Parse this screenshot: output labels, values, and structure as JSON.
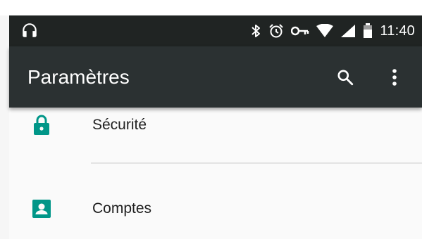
{
  "status_bar": {
    "time": "11:40",
    "left_icon": "headphones-icon",
    "right_icons": [
      "bluetooth-icon",
      "alarm-icon",
      "vpn-key-icon",
      "wifi-icon",
      "cell-signal-icon",
      "battery-icon"
    ]
  },
  "app_bar": {
    "title": "Paramètres",
    "actions": [
      "search-icon",
      "more-vert-icon"
    ]
  },
  "settings_list": {
    "items": [
      {
        "label": "Sécurité",
        "icon": "lock-icon"
      },
      {
        "label": "Comptes",
        "icon": "account-box-icon"
      }
    ]
  },
  "colors": {
    "status_bar": "#202423",
    "app_bar": "#2b3132",
    "accent": "#009688",
    "background": "#fafafa",
    "text": "#212121"
  }
}
